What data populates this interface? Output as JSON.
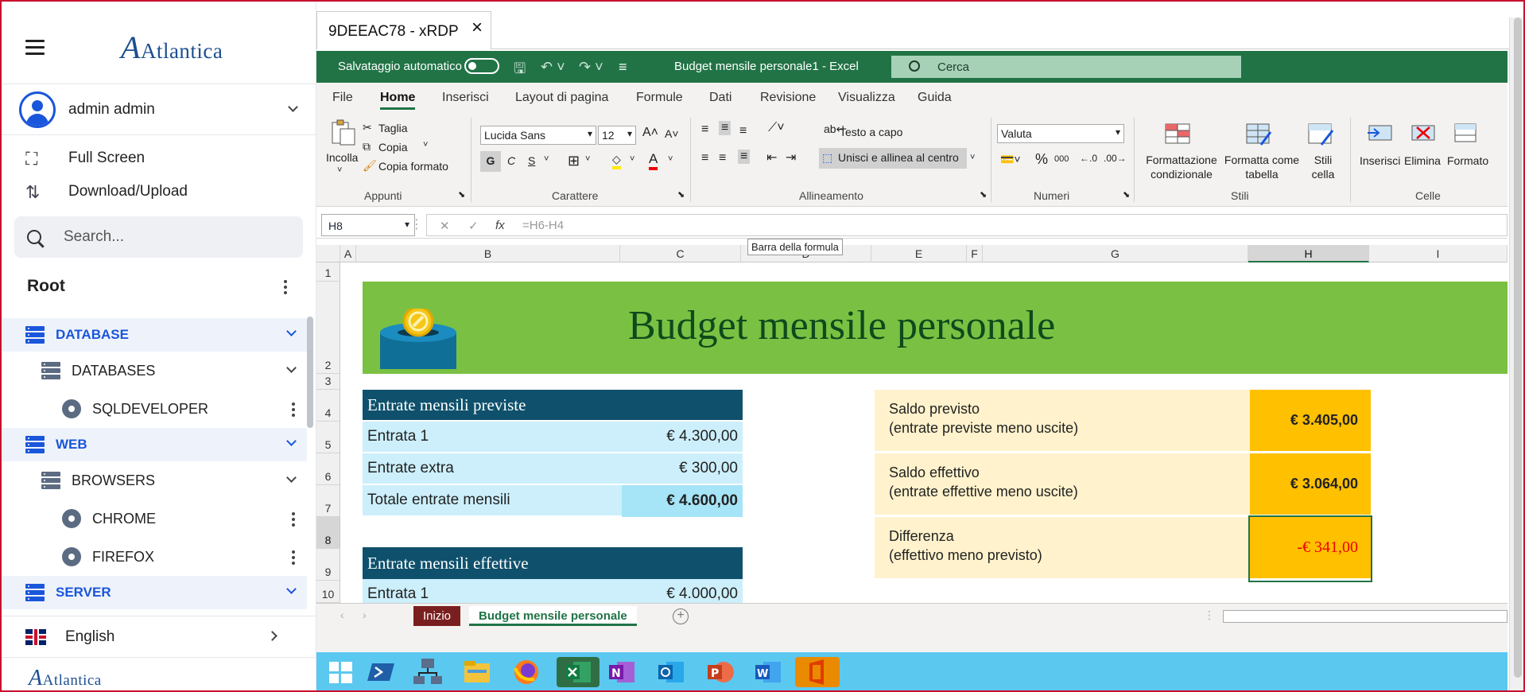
{
  "sidebar": {
    "brand": "Atlantica",
    "user": "admin admin",
    "menu": [
      {
        "label": "Full Screen",
        "icon": "fullscreen-icon"
      },
      {
        "label": "Download/Upload",
        "icon": "transfer-icon"
      }
    ],
    "search_placeholder": "Search...",
    "root": "Root",
    "tree": [
      {
        "label": "DATABASE",
        "type": "group"
      },
      {
        "label": "DATABASES",
        "type": "folder"
      },
      {
        "label": "SQLDEVELOPER",
        "type": "app"
      },
      {
        "label": "WEB",
        "type": "group"
      },
      {
        "label": "BROWSERS",
        "type": "folder"
      },
      {
        "label": "CHROME",
        "type": "app"
      },
      {
        "label": "FIREFOX",
        "type": "app"
      },
      {
        "label": "SERVER",
        "type": "group"
      }
    ],
    "language": "English"
  },
  "remote": {
    "tab": "9DEEAC78 - xRDP",
    "excel": {
      "autosave": "Salvataggio automatico",
      "title": "Budget mensile personale1  -  Excel",
      "search": "Cerca",
      "tabs": [
        "File",
        "Home",
        "Inserisci",
        "Layout di pagina",
        "Formule",
        "Dati",
        "Revisione",
        "Visualizza",
        "Guida"
      ],
      "active_tab": "Home",
      "ribbon": {
        "clipboard": {
          "paste": "Incolla",
          "cut": "Taglia",
          "copy": "Copia",
          "format_painter": "Copia formato",
          "group": "Appunti"
        },
        "font": {
          "name": "Lucida Sans",
          "size": "12",
          "bold": "G",
          "italic": "C",
          "underline": "S",
          "group": "Carattere"
        },
        "alignment": {
          "wrap": "Testo a capo",
          "merge": "Unisci e allinea al centro",
          "group": "Allineamento"
        },
        "number": {
          "format": "Valuta",
          "group": "Numeri"
        },
        "styles": {
          "conditional": "Formattazione condizionale",
          "table": "Formatta come tabella",
          "cell_styles": "Stili cella",
          "group": "Stili"
        },
        "cells": {
          "insert": "Inserisci",
          "delete": "Elimina",
          "format": "Formato",
          "group": "Celle"
        }
      },
      "name_box": "H8",
      "formula": "=H6-H4",
      "tooltip": "Barra della formula",
      "columns": [
        "A",
        "B",
        "C",
        "D",
        "E",
        "F",
        "G",
        "H",
        "I"
      ],
      "rows": [
        "1",
        "2",
        "3",
        "4",
        "5",
        "6",
        "7",
        "8",
        "9",
        "10"
      ],
      "selected_col": "H",
      "selected_row": "8",
      "sheet": {
        "title": "Budget mensile personale",
        "planned_header": "Entrate mensili previste",
        "planned": [
          {
            "label": "Entrata 1",
            "value": "€ 4.300,00"
          },
          {
            "label": "Entrate extra",
            "value": "€ 300,00"
          },
          {
            "label": "Totale entrate mensili",
            "value": "€ 4.600,00"
          }
        ],
        "actual_header": "Entrate mensili effettive",
        "actual": [
          {
            "label": "Entrata 1",
            "value": "€ 4.000,00"
          }
        ],
        "summary": [
          {
            "line1": "Saldo previsto",
            "line2": "(entrate previste meno uscite)",
            "value": "€ 3.405,00"
          },
          {
            "line1": "Saldo effettivo",
            "line2": "(entrate effettive meno uscite)",
            "value": "€ 3.064,00"
          },
          {
            "line1": "Differenza",
            "line2": "(effettivo meno previsto)",
            "value": "-€ 341,00"
          }
        ]
      },
      "sheet_tabs": [
        "Inizio",
        "Budget mensile personale"
      ]
    },
    "taskbar": [
      "windows-start-icon",
      "powershell-icon",
      "network-icon",
      "file-explorer-icon",
      "firefox-icon",
      "excel-icon",
      "onenote-icon",
      "outlook-icon",
      "powerpoint-icon",
      "word-icon",
      "office-icon"
    ]
  },
  "colors": {
    "excel_green": "#217346",
    "header_teal": "#0f516c",
    "banner_green": "#7ac143",
    "accent_blue": "#1a56db",
    "taskbar": "#5bc8f0"
  }
}
